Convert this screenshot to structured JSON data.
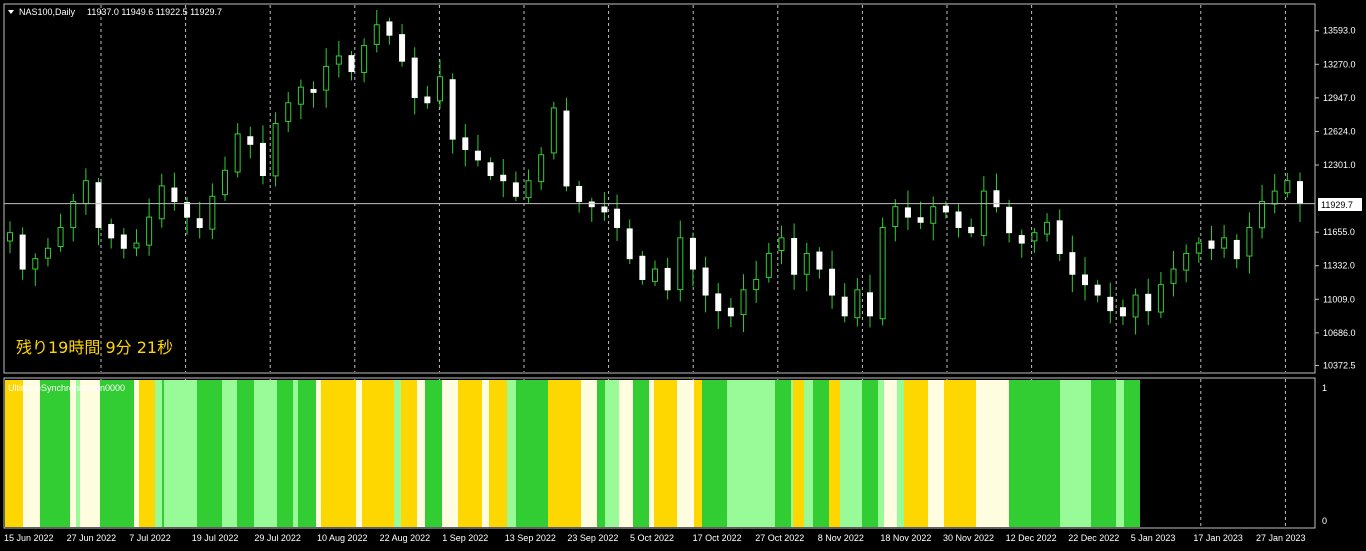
{
  "header": {
    "symbol_timeframe": "NAS100,Daily",
    "ohlc": "11937.0 11949.6 11922.5 11929.7"
  },
  "timer": {
    "text": "残り19時間 9分 21秒"
  },
  "indicator": {
    "title": "UltimateSynchronization0000",
    "axis_top": "1",
    "axis_bottom": "0"
  },
  "current_price": {
    "value": 11929.7,
    "label": "11929.7"
  },
  "colors": {
    "background": "#000000",
    "bull_body": "#ffffff",
    "bull_wick": "#32cd32",
    "bear_body": "#ffffff",
    "grid": "#c0c0c0",
    "bar_green": "#32cd32",
    "bar_lightgreen": "#98fb98",
    "bar_gold": "#ffd700",
    "bar_cream": "#fffde0"
  },
  "chart_data": {
    "type": "candlestick",
    "price_axis": {
      "labels": [
        "13593.0",
        "13270.0",
        "12947.0",
        "12624.0",
        "12301.0",
        "11655.0",
        "11332.0",
        "11009.0",
        "10686.0",
        "10372.5"
      ],
      "range": [
        10300,
        13850
      ]
    },
    "time_axis": {
      "labels": [
        "15 Jun 2022",
        "27 Jun 2022",
        "7 Jul 2022",
        "19 Jul 2022",
        "29 Jul 2022",
        "10 Aug 2022",
        "22 Aug 2022",
        "1 Sep 2022",
        "13 Sep 2022",
        "23 Sep 2022",
        "5 Oct 2022",
        "17 Oct 2022",
        "27 Oct 2022",
        "8 Nov 2022",
        "18 Nov 2022",
        "30 Nov 2022",
        "12 Dec 2022",
        "22 Dec 2022",
        "5 Jan 2023",
        "17 Jan 2023",
        "27 Jan 2023"
      ]
    },
    "close_path": [
      11650,
      11300,
      11400,
      11500,
      11700,
      11950,
      12150,
      11700,
      11600,
      11500,
      11550,
      11800,
      12100,
      11950,
      11800,
      11700,
      12000,
      12250,
      12600,
      12500,
      12200,
      12700,
      12900,
      13050,
      13000,
      13250,
      13350,
      13200,
      13450,
      13650,
      13550,
      13300,
      12950,
      12900,
      13150,
      12550,
      12450,
      12350,
      12200,
      12150,
      12000,
      12150,
      12400,
      12850,
      12100,
      11950,
      11900,
      11850,
      11700,
      11400,
      11200,
      11300,
      11100,
      11600,
      11300,
      11050,
      10900,
      10850,
      11100,
      11200,
      11450,
      11600,
      11250,
      11450,
      11300,
      11050,
      10850,
      11100,
      10850,
      11700,
      11900,
      11800,
      11750,
      11900,
      11850,
      11700,
      11650,
      12050,
      11900,
      11650,
      11550,
      11650,
      11750,
      11450,
      11250,
      11150,
      11050,
      10900,
      10850,
      11050,
      10900,
      11150,
      11300,
      11450,
      11550,
      11500,
      11600,
      11400,
      11700,
      11950,
      12050,
      12150,
      11930
    ]
  },
  "indicator_data": {
    "type": "histogram-colorbars",
    "segments": [
      [
        "gold",
        18
      ],
      [
        "cream",
        17
      ],
      [
        "green",
        30
      ],
      [
        "cream",
        6
      ],
      [
        "lightgreen",
        4
      ],
      [
        "cream",
        20
      ],
      [
        "green",
        34
      ],
      [
        "cream",
        5
      ],
      [
        "gold",
        16
      ],
      [
        "lightgreen",
        7
      ],
      [
        "green",
        2
      ],
      [
        "lightgreen",
        33
      ],
      [
        "green",
        25
      ],
      [
        "lightgreen",
        15
      ],
      [
        "green",
        17
      ],
      [
        "lightgreen",
        23
      ],
      [
        "green",
        16
      ],
      [
        "lightgreen",
        5
      ],
      [
        "green",
        18
      ],
      [
        "cream",
        5
      ],
      [
        "gold",
        35
      ],
      [
        "cream",
        6
      ],
      [
        "gold",
        32
      ],
      [
        "lightgreen",
        7
      ],
      [
        "gold",
        16
      ],
      [
        "cream",
        8
      ],
      [
        "green",
        17
      ],
      [
        "cream",
        16
      ],
      [
        "gold",
        24
      ],
      [
        "cream",
        7
      ],
      [
        "gold",
        18
      ],
      [
        "lightgreen",
        9
      ],
      [
        "green",
        32
      ],
      [
        "gold",
        33
      ],
      [
        "cream",
        16
      ],
      [
        "green",
        8
      ],
      [
        "lightgreen",
        14
      ],
      [
        "cream",
        14
      ],
      [
        "green",
        16
      ],
      [
        "cream",
        5
      ],
      [
        "gold",
        23
      ],
      [
        "cream",
        17
      ],
      [
        "gold",
        8
      ],
      [
        "green",
        25
      ],
      [
        "lightgreen",
        48
      ],
      [
        "green",
        16
      ],
      [
        "lightgreen",
        2
      ],
      [
        "gold",
        11
      ],
      [
        "lightgreen",
        9
      ],
      [
        "green",
        16
      ],
      [
        "gold",
        11
      ],
      [
        "lightgreen",
        22
      ],
      [
        "green",
        16
      ],
      [
        "lightgreen",
        6
      ],
      [
        "cream",
        13
      ],
      [
        "lightgreen",
        7
      ],
      [
        "gold",
        24
      ],
      [
        "cream",
        16
      ],
      [
        "gold",
        32
      ],
      [
        "cream",
        33
      ],
      [
        "green",
        51
      ],
      [
        "lightgreen",
        31
      ],
      [
        "green",
        25
      ],
      [
        "lightgreen",
        8
      ],
      [
        "green",
        16
      ],
      [
        "gold",
        0
      ]
    ]
  }
}
